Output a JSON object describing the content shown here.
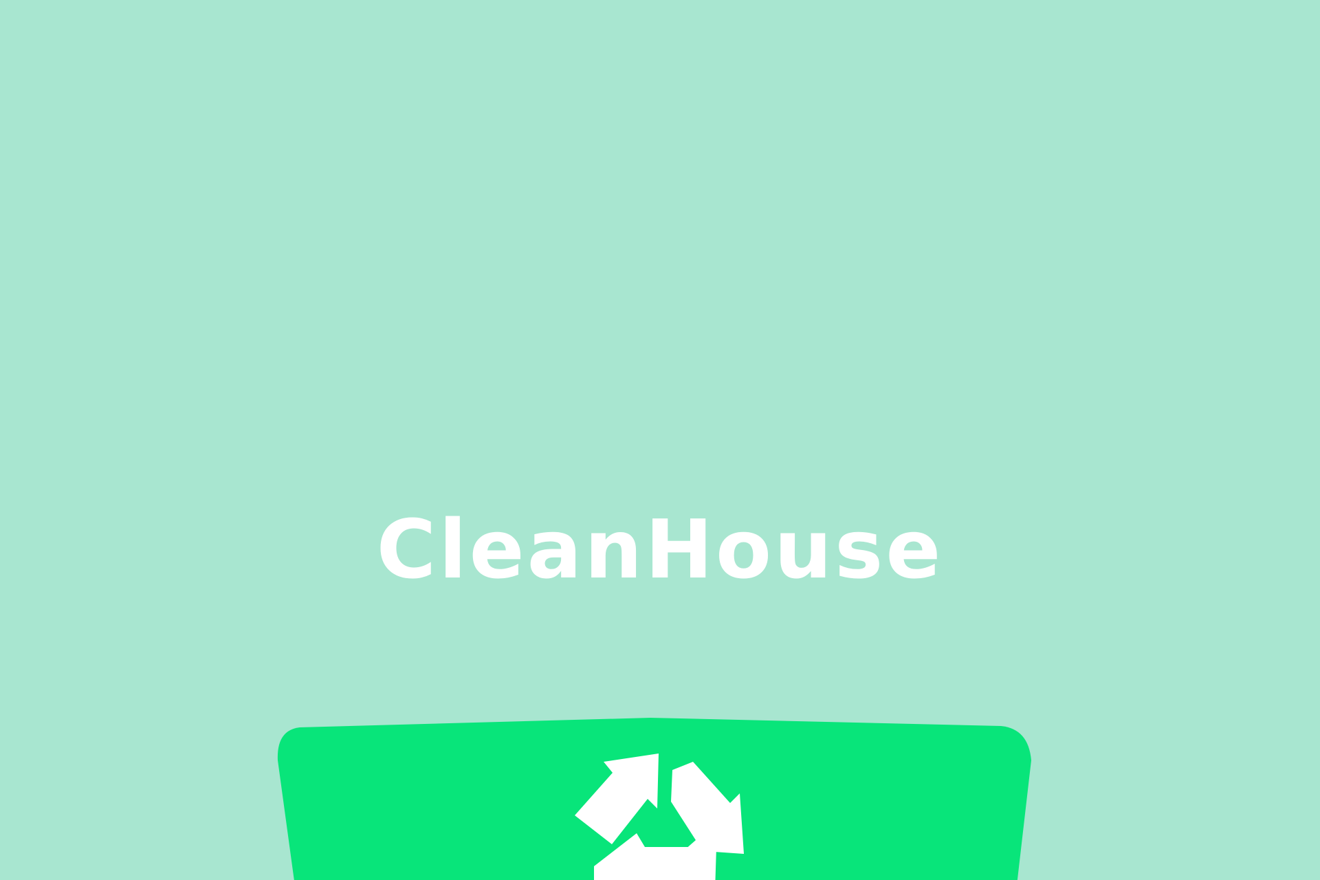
{
  "app": {
    "title": "CleanHouse"
  },
  "icons": {
    "logo": "recycling-bin-icon",
    "symbol": "recycle-arrows-icon"
  },
  "colors": {
    "background": "#a8e6d0",
    "bin": "#08e57a",
    "title": "#ffffff"
  }
}
